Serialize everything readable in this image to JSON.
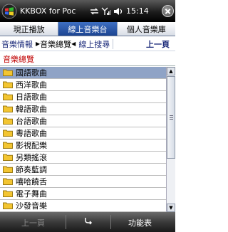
{
  "titlebar": {
    "title": "KKBOX for Poc",
    "time": "15:14",
    "icons": [
      "windows-start-icon",
      "sync-icon",
      "signal-icon",
      "volume-icon",
      "ok-close-icon"
    ]
  },
  "main_tabs": [
    {
      "label": "現正播放",
      "active": false
    },
    {
      "label": "線上音樂台",
      "active": true
    },
    {
      "label": "個人音樂庫",
      "active": false
    }
  ],
  "sub_nav": {
    "info": "音樂情報",
    "browse": "音樂總覽",
    "search": "線上搜尋",
    "back": "上一頁"
  },
  "section": {
    "title": "音樂總覽"
  },
  "list": {
    "items": [
      {
        "label": "國語歌曲",
        "selected": true
      },
      {
        "label": "西洋歌曲",
        "selected": false
      },
      {
        "label": "日語歌曲",
        "selected": false
      },
      {
        "label": "韓語歌曲",
        "selected": false
      },
      {
        "label": "台語歌曲",
        "selected": false
      },
      {
        "label": "粵語歌曲",
        "selected": false
      },
      {
        "label": "影視配樂",
        "selected": false
      },
      {
        "label": "另類搖滾",
        "selected": false
      },
      {
        "label": "節奏藍調",
        "selected": false
      },
      {
        "label": "嘻哈饒舌",
        "selected": false
      },
      {
        "label": "電子舞曲",
        "selected": false
      },
      {
        "label": "沙發音樂",
        "selected": false
      }
    ]
  },
  "softkeys": {
    "left": "上一頁",
    "right": "功能表"
  },
  "colors": {
    "accent": "#1c4491",
    "selected_row": "#8fa3c6",
    "section_title": "#c00000"
  }
}
